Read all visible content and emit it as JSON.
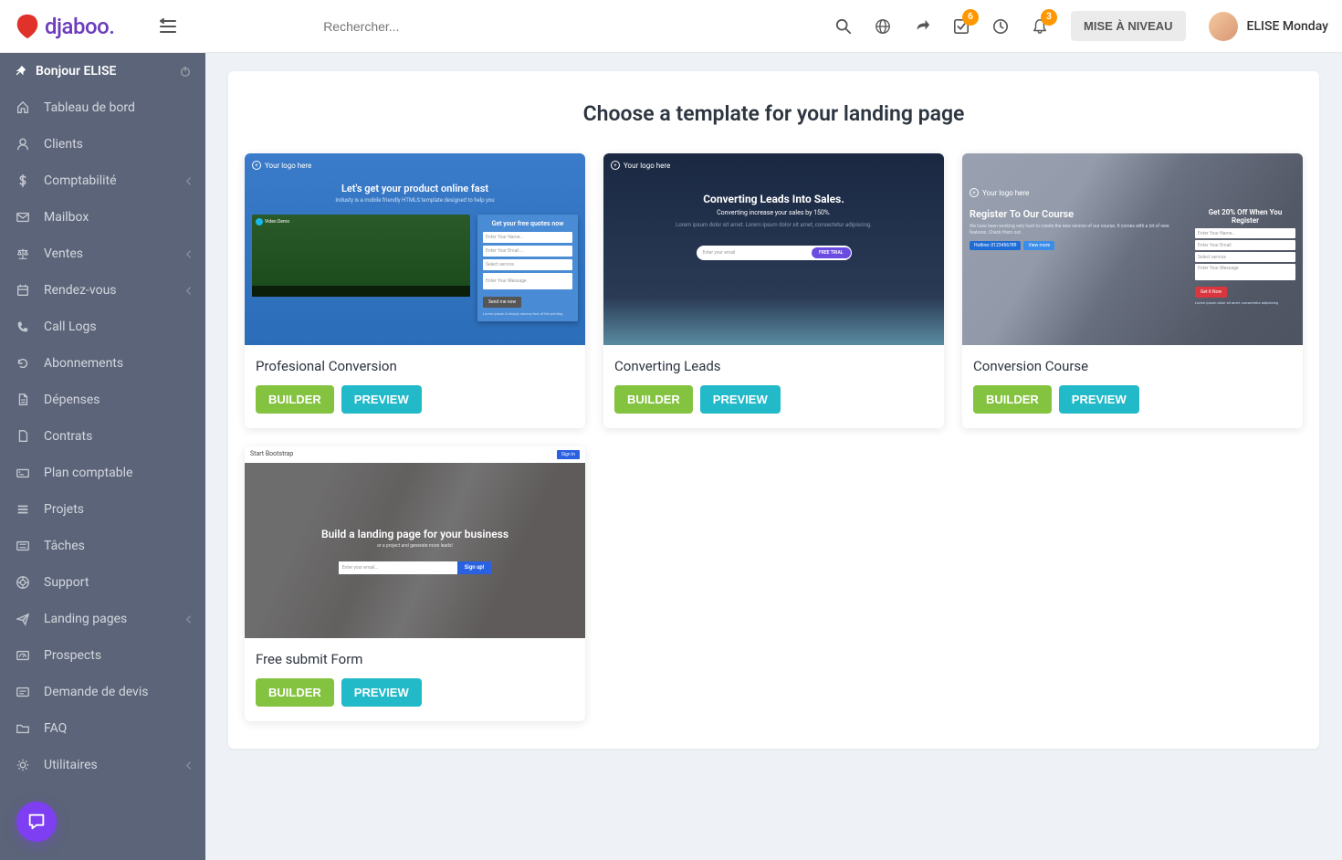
{
  "brand": {
    "name": "djaboo."
  },
  "header": {
    "search_placeholder": "Rechercher...",
    "upgrade_label": "MISE À NIVEAU",
    "badges": {
      "tasks": "6",
      "notifications": "3"
    },
    "user_name": "ELISE Monday"
  },
  "sidebar": {
    "greeting": "Bonjour ELISE",
    "items": [
      {
        "label": "Tableau de bord",
        "icon": "home",
        "expandable": false
      },
      {
        "label": "Clients",
        "icon": "user",
        "expandable": false
      },
      {
        "label": "Comptabilité",
        "icon": "dollar",
        "expandable": true
      },
      {
        "label": "Mailbox",
        "icon": "mail",
        "expandable": false
      },
      {
        "label": "Ventes",
        "icon": "scale",
        "expandable": true
      },
      {
        "label": "Rendez-vous",
        "icon": "calendar",
        "expandable": true
      },
      {
        "label": "Call Logs",
        "icon": "phone",
        "expandable": false
      },
      {
        "label": "Abonnements",
        "icon": "refresh",
        "expandable": false
      },
      {
        "label": "Dépenses",
        "icon": "file",
        "expandable": false
      },
      {
        "label": "Contrats",
        "icon": "doc",
        "expandable": false
      },
      {
        "label": "Plan comptable",
        "icon": "card",
        "expandable": false
      },
      {
        "label": "Projets",
        "icon": "bars",
        "expandable": false
      },
      {
        "label": "Tâches",
        "icon": "list",
        "expandable": false
      },
      {
        "label": "Support",
        "icon": "life",
        "expandable": false
      },
      {
        "label": "Landing pages",
        "icon": "plane",
        "expandable": true
      },
      {
        "label": "Prospects",
        "icon": "dash",
        "expandable": false
      },
      {
        "label": "Demande de devis",
        "icon": "quote",
        "expandable": false
      },
      {
        "label": "FAQ",
        "icon": "folder",
        "expandable": false
      },
      {
        "label": "Utilitaires",
        "icon": "gear",
        "expandable": true
      }
    ]
  },
  "main": {
    "title": "Choose a template for your landing page",
    "builder_label": "BUILDER",
    "preview_label": "PREVIEW",
    "templates": [
      {
        "name": "Profesional Conversion",
        "thumb": "thumb1"
      },
      {
        "name": "Converting Leads",
        "thumb": "thumb2"
      },
      {
        "name": "Conversion Course",
        "thumb": "thumb3"
      },
      {
        "name": "Free submit Form",
        "thumb": "thumb4"
      }
    ]
  },
  "mini": {
    "logo_text": "Your logo here",
    "t1": {
      "headline": "Let's get your product online fast",
      "sub": "Industy is a mobile friendly HTMLS template designed to help you",
      "form_title": "Get your free quotes now",
      "f1": "Enter Your Name...",
      "f2": "Enter Your Email ...",
      "f3": "Select service",
      "f4": "Enter Your Message",
      "btn": "Send me now",
      "small": "Lorem ipsum & simply dummy text of the printing",
      "vimeo": "Video Demo"
    },
    "t2": {
      "headline": "Converting Leads Into Sales.",
      "sub": "Converting increase your sales by 150%.",
      "desc": "Lorem ipsum dolor sit amet. Lorem ipsum dolor sit amet, consectetur adipiscing.",
      "pill_input": "Enter your email",
      "pill_btn": "FREE TRIAL"
    },
    "t3": {
      "form_title": "Get 20% Off When You Register",
      "title": "Register To Our Course",
      "desc": "We have been working very hard to create the new version of our course. It comes with a lot of new features. Check them out.",
      "badge1": "Hotline: 0123456789",
      "badge2": "View more",
      "f1": "Enter Your Name...",
      "f2": "Enter Your Email",
      "f3": "Select service",
      "f4": "Enter Your Message",
      "btn": "Get it Now",
      "small": "Lorem ipsum dolor sit amet, consectetur adipiscing"
    },
    "t4": {
      "brand": "Start Bootstrap",
      "signin": "Sign In",
      "title": "Build a landing page for your business",
      "sub": "or a project and generate more leads!",
      "input": "Enter your email...",
      "btn": "Sign up!"
    }
  }
}
